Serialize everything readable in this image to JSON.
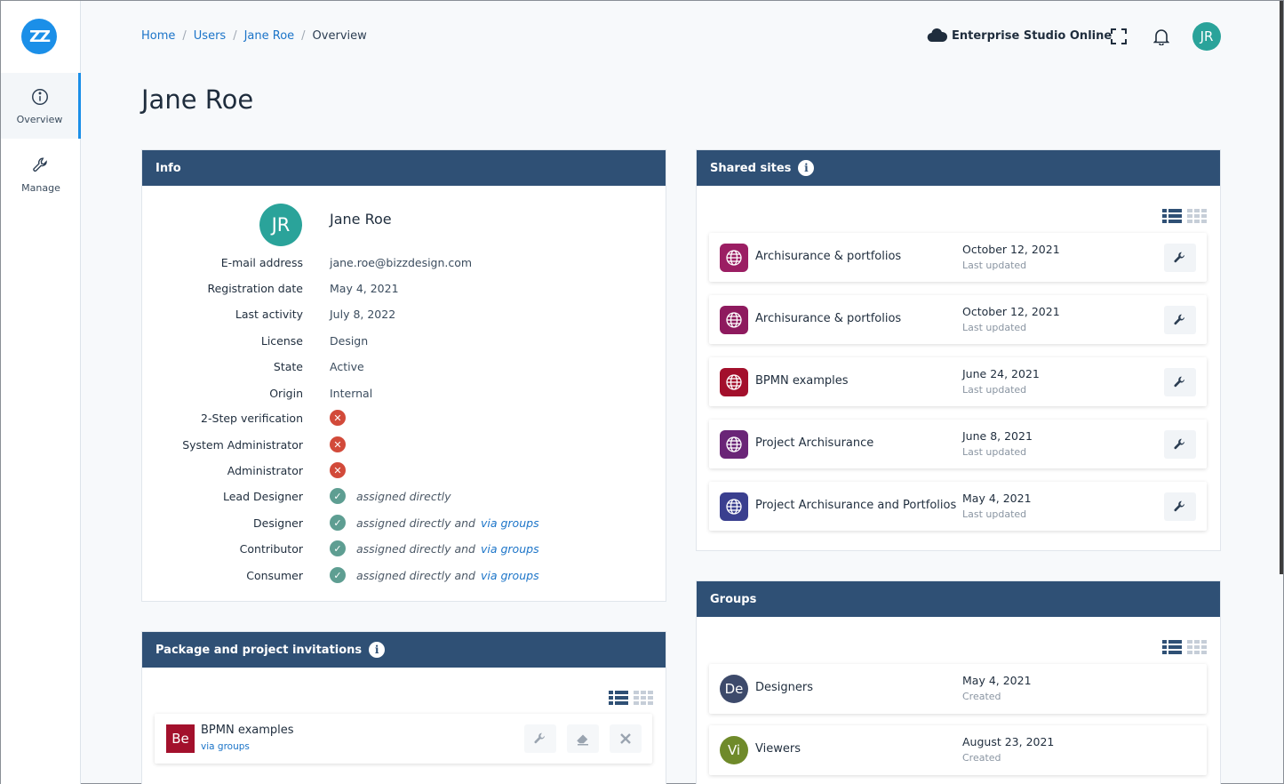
{
  "sidebar": {
    "logo": "ZZ",
    "items": [
      {
        "label": "Overview",
        "icon": "info-circle-icon"
      },
      {
        "label": "Manage",
        "icon": "wrench-icon"
      }
    ]
  },
  "breadcrumb": [
    "Home",
    "Users",
    "Jane Roe",
    "Overview"
  ],
  "breadcrumb_sep": "/",
  "environment": "Enterprise Studio Online",
  "user_initials": "JR",
  "page_title": "Jane Roe",
  "info": {
    "title": "Info",
    "name": "Jane Roe",
    "initials": "JR",
    "rows": [
      {
        "label": "E-mail address",
        "value": "jane.roe@bizzdesign.com"
      },
      {
        "label": "Registration date",
        "value": "May 4, 2021"
      },
      {
        "label": "Last activity",
        "value": "July 8, 2022"
      },
      {
        "label": "License",
        "value": "Design"
      },
      {
        "label": "State",
        "value": "Active"
      },
      {
        "label": "Origin",
        "value": "Internal"
      }
    ],
    "flags": [
      {
        "label": "2-Step verification",
        "status": "no"
      },
      {
        "label": "System Administrator",
        "status": "no"
      },
      {
        "label": "Administrator",
        "status": "no"
      }
    ],
    "roles": [
      {
        "label": "Lead Designer",
        "text": "assigned directly",
        "link": ""
      },
      {
        "label": "Designer",
        "text": "assigned directly and",
        "link": "via groups"
      },
      {
        "label": "Contributor",
        "text": "assigned directly and",
        "link": "via groups"
      },
      {
        "label": "Consumer",
        "text": "assigned directly and",
        "link": "via groups"
      }
    ]
  },
  "invitations": {
    "title": "Package and project invitations",
    "items": [
      {
        "badge": "Be",
        "name": "BPMN examples",
        "sub": "via groups"
      }
    ]
  },
  "shared_sites": {
    "title": "Shared sites",
    "items": [
      {
        "name": "Archisurance & portfolios",
        "date": "October 12, 2021",
        "sub": "Last updated",
        "color": "#9b1e63"
      },
      {
        "name": "Archisurance & portfolios",
        "date": "October 12, 2021",
        "sub": "Last updated",
        "color": "#8e1a5e"
      },
      {
        "name": "BPMN examples",
        "date": "June 24, 2021",
        "sub": "Last updated",
        "color": "#a3102c"
      },
      {
        "name": "Project Archisurance",
        "date": "June 8, 2021",
        "sub": "Last updated",
        "color": "#6a2577"
      },
      {
        "name": "Project Archisurance and Portfolios",
        "date": "May 4, 2021",
        "sub": "Last updated",
        "color": "#3a3f8f"
      }
    ]
  },
  "groups": {
    "title": "Groups",
    "items": [
      {
        "initials": "De",
        "name": "Designers",
        "date": "May 4, 2021",
        "sub": "Created",
        "color": "#3d4a6b"
      },
      {
        "initials": "Vi",
        "name": "Viewers",
        "date": "August 23, 2021",
        "sub": "Created",
        "color": "#6f8a2a"
      }
    ]
  }
}
